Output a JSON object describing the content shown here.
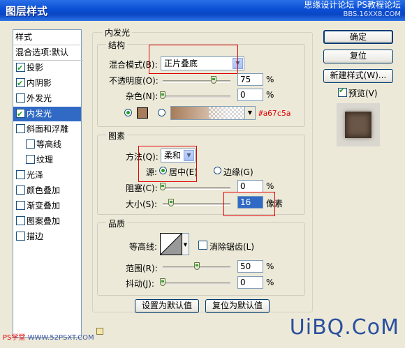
{
  "window": {
    "title": "图层样式",
    "watermark_line1": "思缘设计论坛 PS教程论坛",
    "watermark_line2": "BBS.16XX8.COM"
  },
  "left_panel": {
    "header": "样式",
    "blend_options": "混合选项:默认",
    "items": [
      {
        "label": "投影",
        "checked": true
      },
      {
        "label": "内阴影",
        "checked": true
      },
      {
        "label": "外发光",
        "checked": false
      },
      {
        "label": "内发光",
        "checked": true,
        "selected": true
      },
      {
        "label": "斜面和浮雕",
        "checked": false
      },
      {
        "label": "等高线",
        "checked": false,
        "sub": true
      },
      {
        "label": "纹理",
        "checked": false,
        "sub": true
      },
      {
        "label": "光泽",
        "checked": false
      },
      {
        "label": "颜色叠加",
        "checked": false
      },
      {
        "label": "渐变叠加",
        "checked": false
      },
      {
        "label": "图案叠加",
        "checked": false
      },
      {
        "label": "描边",
        "checked": false
      }
    ]
  },
  "inner_glow": {
    "title": "内发光",
    "structure": {
      "title": "结构",
      "blend_mode_label": "混合模式(B):",
      "blend_mode_value": "正片叠底",
      "opacity_label": "不透明度(O):",
      "opacity_value": "75",
      "opacity_fraction": 0.75,
      "noise_label": "杂色(N):",
      "noise_value": "0",
      "noise_fraction": 0,
      "percent": "%",
      "color_hex": "#a67c5a",
      "color_label": "#a67c5a"
    },
    "elements": {
      "title": "图素",
      "technique_label": "方法(Q):",
      "technique_value": "柔和",
      "source_label": "源:",
      "source_center": "居中(E)",
      "source_edge": "边缘(G)",
      "choke_label": "阻塞(C):",
      "choke_value": "0",
      "choke_fraction": 0,
      "size_label": "大小(S):",
      "size_value": "16",
      "size_fraction": 0.065,
      "size_unit": "像素",
      "percent": "%"
    },
    "quality": {
      "title": "品质",
      "contour_label": "等高线:",
      "antialias_label": "消除锯齿(L)",
      "range_label": "范围(R):",
      "range_value": "50",
      "range_fraction": 0.5,
      "jitter_label": "抖动(J):",
      "jitter_value": "0",
      "jitter_fraction": 0,
      "percent": "%"
    },
    "make_default": "设置为默认值",
    "reset_default": "复位为默认值"
  },
  "right_buttons": {
    "ok": "确定",
    "reset": "复位",
    "new_style": "新建样式(W)...",
    "preview_label": "预览(V)"
  },
  "watermarks": {
    "bottom_left_red": "PS学堂",
    "bottom_left_blue": "WWW.52PSXT.COM",
    "brand": "UiBQ.CoM"
  }
}
